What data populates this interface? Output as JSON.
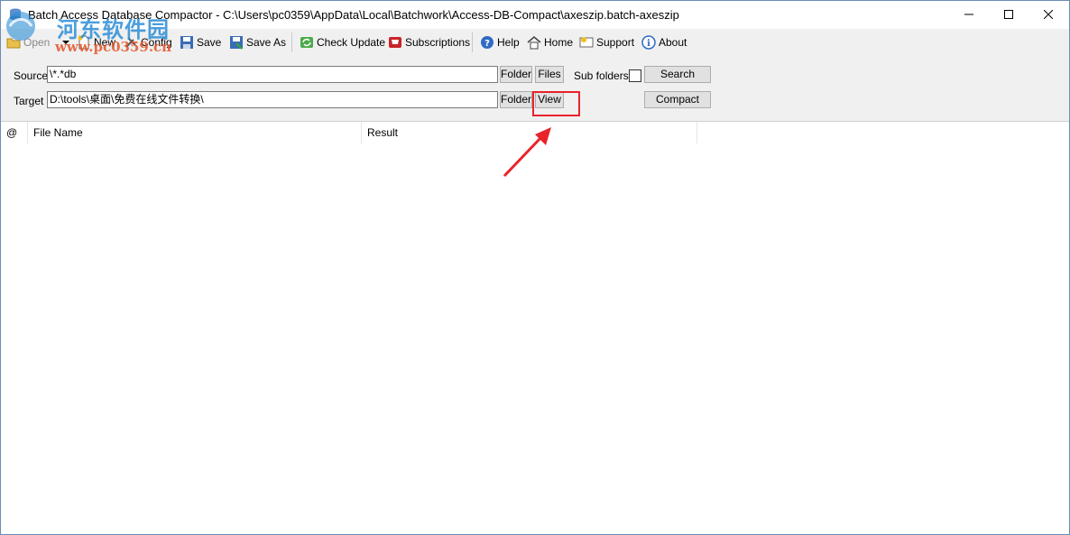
{
  "window": {
    "title": "Batch Access Database Compactor - C:\\Users\\pc0359\\AppData\\Local\\Batchwork\\Access-DB-Compact\\axeszip.batch-axeszip"
  },
  "watermark": {
    "cn": "河东软件园",
    "url": "www.pc0359.cn"
  },
  "toolbar": {
    "open": "Open",
    "new": "New",
    "config": "Config",
    "save": "Save",
    "save_as": "Save As",
    "check_update": "Check Update",
    "subscriptions": "Subscriptions",
    "help": "Help",
    "home": "Home",
    "support": "Support",
    "about": "About"
  },
  "form": {
    "source_label": "Source",
    "source_value": "\\*.*db",
    "target_label": "Target",
    "target_value": "D:\\tools\\桌面\\免费在线文件转换\\",
    "folder_btn": "Folder",
    "files_btn": "Files",
    "subfolders_label": "Sub folders",
    "subfolders_checked": false,
    "view_btn": "View",
    "search_btn": "Search",
    "compact_btn": "Compact"
  },
  "list": {
    "columns": [
      "@",
      "File Name",
      "Result"
    ],
    "rows": []
  },
  "colors": {
    "annotation_red": "#e8232a",
    "toolbar_bg": "#f0f0f0"
  }
}
